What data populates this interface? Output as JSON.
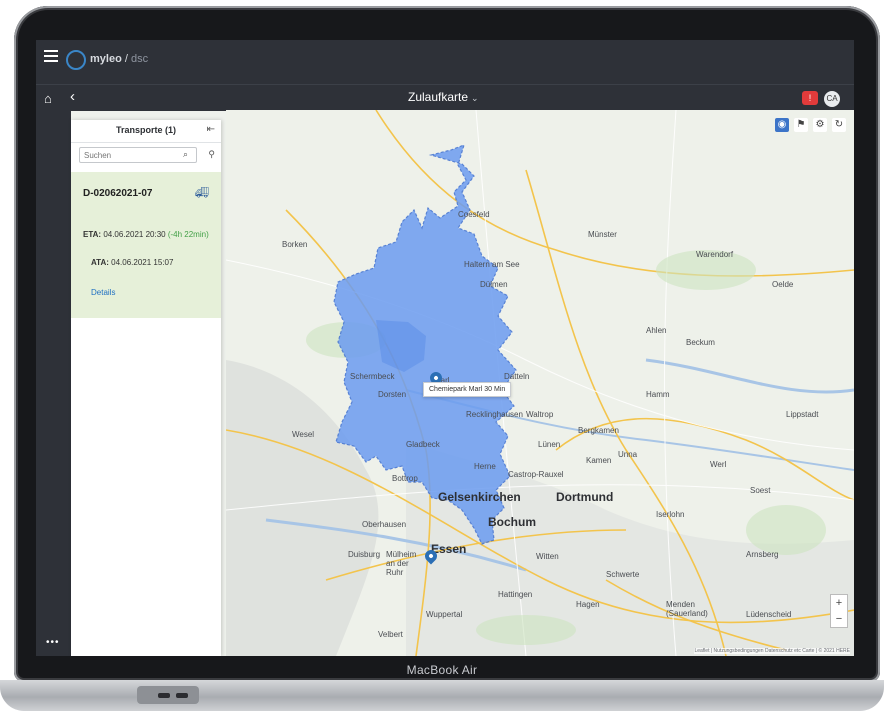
{
  "device": {
    "brand_label": "MacBook Air"
  },
  "app": {
    "logo_name": "myleo",
    "logo_suffix": "dsc"
  },
  "header": {
    "title": "Zulaufkarte",
    "avatar_initials": "CA"
  },
  "panel": {
    "title": "Transporte (1)",
    "search_placeholder": "Suchen",
    "card": {
      "id": "D-02062021-07",
      "eta_label": "ETA:",
      "eta_value": "04.06.2021 20:30",
      "eta_delay": "(-4h 22min)",
      "ata_label": "ATA:",
      "ata_value": "04.06.2021 15:07",
      "details_link": "Details"
    }
  },
  "map": {
    "tooltip": "Chemiepark Marl 30 Min",
    "cities": [
      "Gelsenkirchen",
      "Bochum",
      "Dortmund",
      "Essen",
      "Oberhausen",
      "Duisburg",
      "Mülheim an der Ruhr",
      "Recklinghausen",
      "Marl",
      "Bottrop",
      "Gladbeck",
      "Dorsten",
      "Hamm",
      "Unna",
      "Herne",
      "Witten",
      "Hagen",
      "Lünen",
      "Castrop-Rauxel",
      "Haltern am See",
      "Datteln",
      "Waltrop",
      "Bergkamen",
      "Kamen",
      "Schwerte",
      "Soest",
      "Lippstadt",
      "Arnsberg",
      "Menden (Sauerland)",
      "Coesfeld",
      "Dülmen",
      "Münster",
      "Warendorf",
      "Ahlen",
      "Beckum",
      "Borken",
      "Schermbeck",
      "Velbert",
      "Hattingen",
      "Wesel",
      "Werl",
      "Oelde",
      "Iserlohn",
      "Lüdenscheid",
      "Wuppertal"
    ],
    "attribution": "Leaflet | Nutzungsbedingungen Datenschutz etc Carte | © 2021 HERE",
    "isochrone_color": "#6c9cf0",
    "accent_color": "#3c74c8"
  }
}
